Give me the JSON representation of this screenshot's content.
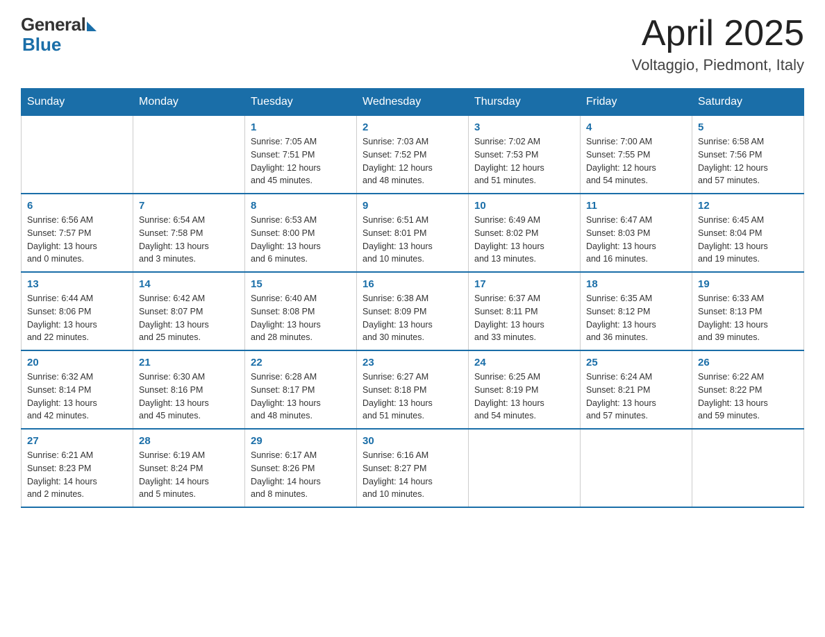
{
  "header": {
    "logo_general": "General",
    "logo_blue": "Blue",
    "title": "April 2025",
    "location": "Voltaggio, Piedmont, Italy"
  },
  "calendar": {
    "days_of_week": [
      "Sunday",
      "Monday",
      "Tuesday",
      "Wednesday",
      "Thursday",
      "Friday",
      "Saturday"
    ],
    "weeks": [
      [
        {
          "day": "",
          "info": ""
        },
        {
          "day": "",
          "info": ""
        },
        {
          "day": "1",
          "info": "Sunrise: 7:05 AM\nSunset: 7:51 PM\nDaylight: 12 hours\nand 45 minutes."
        },
        {
          "day": "2",
          "info": "Sunrise: 7:03 AM\nSunset: 7:52 PM\nDaylight: 12 hours\nand 48 minutes."
        },
        {
          "day": "3",
          "info": "Sunrise: 7:02 AM\nSunset: 7:53 PM\nDaylight: 12 hours\nand 51 minutes."
        },
        {
          "day": "4",
          "info": "Sunrise: 7:00 AM\nSunset: 7:55 PM\nDaylight: 12 hours\nand 54 minutes."
        },
        {
          "day": "5",
          "info": "Sunrise: 6:58 AM\nSunset: 7:56 PM\nDaylight: 12 hours\nand 57 minutes."
        }
      ],
      [
        {
          "day": "6",
          "info": "Sunrise: 6:56 AM\nSunset: 7:57 PM\nDaylight: 13 hours\nand 0 minutes."
        },
        {
          "day": "7",
          "info": "Sunrise: 6:54 AM\nSunset: 7:58 PM\nDaylight: 13 hours\nand 3 minutes."
        },
        {
          "day": "8",
          "info": "Sunrise: 6:53 AM\nSunset: 8:00 PM\nDaylight: 13 hours\nand 6 minutes."
        },
        {
          "day": "9",
          "info": "Sunrise: 6:51 AM\nSunset: 8:01 PM\nDaylight: 13 hours\nand 10 minutes."
        },
        {
          "day": "10",
          "info": "Sunrise: 6:49 AM\nSunset: 8:02 PM\nDaylight: 13 hours\nand 13 minutes."
        },
        {
          "day": "11",
          "info": "Sunrise: 6:47 AM\nSunset: 8:03 PM\nDaylight: 13 hours\nand 16 minutes."
        },
        {
          "day": "12",
          "info": "Sunrise: 6:45 AM\nSunset: 8:04 PM\nDaylight: 13 hours\nand 19 minutes."
        }
      ],
      [
        {
          "day": "13",
          "info": "Sunrise: 6:44 AM\nSunset: 8:06 PM\nDaylight: 13 hours\nand 22 minutes."
        },
        {
          "day": "14",
          "info": "Sunrise: 6:42 AM\nSunset: 8:07 PM\nDaylight: 13 hours\nand 25 minutes."
        },
        {
          "day": "15",
          "info": "Sunrise: 6:40 AM\nSunset: 8:08 PM\nDaylight: 13 hours\nand 28 minutes."
        },
        {
          "day": "16",
          "info": "Sunrise: 6:38 AM\nSunset: 8:09 PM\nDaylight: 13 hours\nand 30 minutes."
        },
        {
          "day": "17",
          "info": "Sunrise: 6:37 AM\nSunset: 8:11 PM\nDaylight: 13 hours\nand 33 minutes."
        },
        {
          "day": "18",
          "info": "Sunrise: 6:35 AM\nSunset: 8:12 PM\nDaylight: 13 hours\nand 36 minutes."
        },
        {
          "day": "19",
          "info": "Sunrise: 6:33 AM\nSunset: 8:13 PM\nDaylight: 13 hours\nand 39 minutes."
        }
      ],
      [
        {
          "day": "20",
          "info": "Sunrise: 6:32 AM\nSunset: 8:14 PM\nDaylight: 13 hours\nand 42 minutes."
        },
        {
          "day": "21",
          "info": "Sunrise: 6:30 AM\nSunset: 8:16 PM\nDaylight: 13 hours\nand 45 minutes."
        },
        {
          "day": "22",
          "info": "Sunrise: 6:28 AM\nSunset: 8:17 PM\nDaylight: 13 hours\nand 48 minutes."
        },
        {
          "day": "23",
          "info": "Sunrise: 6:27 AM\nSunset: 8:18 PM\nDaylight: 13 hours\nand 51 minutes."
        },
        {
          "day": "24",
          "info": "Sunrise: 6:25 AM\nSunset: 8:19 PM\nDaylight: 13 hours\nand 54 minutes."
        },
        {
          "day": "25",
          "info": "Sunrise: 6:24 AM\nSunset: 8:21 PM\nDaylight: 13 hours\nand 57 minutes."
        },
        {
          "day": "26",
          "info": "Sunrise: 6:22 AM\nSunset: 8:22 PM\nDaylight: 13 hours\nand 59 minutes."
        }
      ],
      [
        {
          "day": "27",
          "info": "Sunrise: 6:21 AM\nSunset: 8:23 PM\nDaylight: 14 hours\nand 2 minutes."
        },
        {
          "day": "28",
          "info": "Sunrise: 6:19 AM\nSunset: 8:24 PM\nDaylight: 14 hours\nand 5 minutes."
        },
        {
          "day": "29",
          "info": "Sunrise: 6:17 AM\nSunset: 8:26 PM\nDaylight: 14 hours\nand 8 minutes."
        },
        {
          "day": "30",
          "info": "Sunrise: 6:16 AM\nSunset: 8:27 PM\nDaylight: 14 hours\nand 10 minutes."
        },
        {
          "day": "",
          "info": ""
        },
        {
          "day": "",
          "info": ""
        },
        {
          "day": "",
          "info": ""
        }
      ]
    ]
  }
}
